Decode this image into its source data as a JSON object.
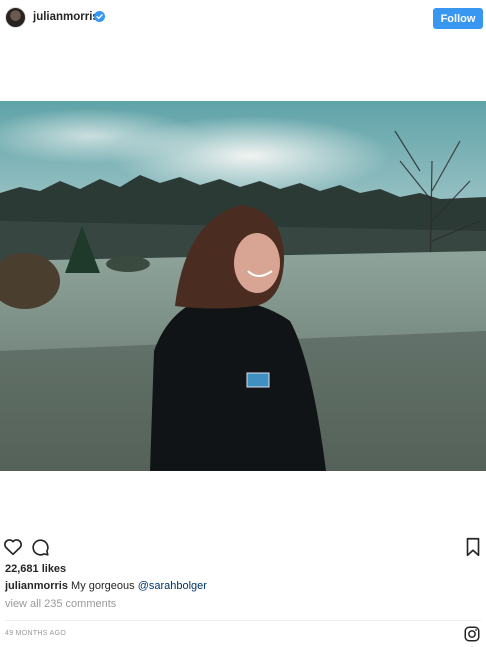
{
  "header": {
    "username": "julianmorris",
    "verified": true,
    "follow_label": "Follow"
  },
  "post": {
    "image_icon": "photo"
  },
  "actions": {
    "like_icon": "heart-icon",
    "comment_icon": "comment-icon",
    "save_icon": "bookmark-icon"
  },
  "likes": "22,681 likes",
  "caption": {
    "username": "julianmorris",
    "text": "My gorgeous",
    "mention": "@sarahbolger"
  },
  "comments_link": "view all 235 comments",
  "timestamp": "49 MONTHS AGO",
  "colors": {
    "accent": "#3897f0",
    "muted": "#999999",
    "text": "#262626"
  }
}
